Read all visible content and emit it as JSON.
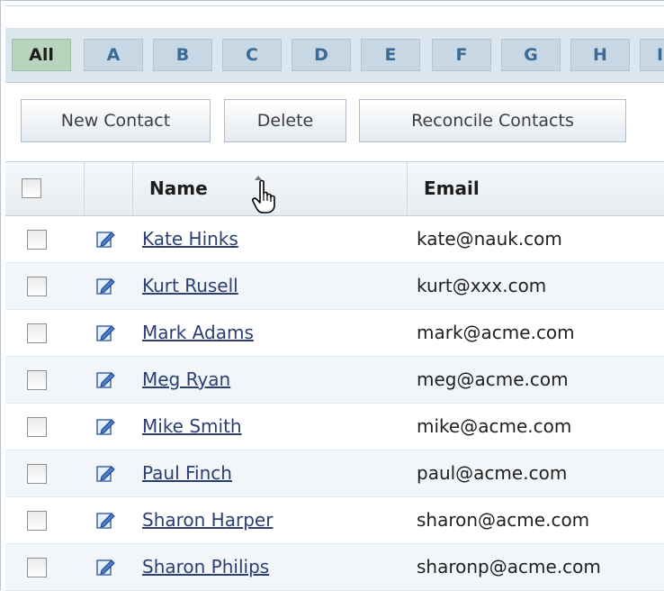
{
  "alphabet": {
    "tabs": [
      "All",
      "A",
      "B",
      "C",
      "D",
      "E",
      "F",
      "G",
      "H",
      "I"
    ],
    "active": "All"
  },
  "toolbar": {
    "new_contact": "New Contact",
    "delete": "Delete",
    "reconcile": "Reconcile Contacts"
  },
  "table": {
    "columns": {
      "name": "Name",
      "email": "Email"
    },
    "sort": {
      "column": "Name",
      "direction": "ascending"
    },
    "rows": [
      {
        "name": "Kate Hinks",
        "email": "kate@nauk.com"
      },
      {
        "name": "Kurt Rusell",
        "email": "kurt@xxx.com"
      },
      {
        "name": "Mark Adams",
        "email": "mark@acme.com"
      },
      {
        "name": "Meg Ryan",
        "email": "meg@acme.com"
      },
      {
        "name": "Mike Smith",
        "email": "mike@acme.com"
      },
      {
        "name": "Paul Finch",
        "email": "paul@acme.com"
      },
      {
        "name": "Sharon Harper",
        "email": "sharon@acme.com"
      },
      {
        "name": "Sharon Philips",
        "email": "sharonp@acme.com"
      }
    ]
  },
  "icons": {
    "edit": "edit-pencil-icon",
    "sort": "sort-ascending-icon",
    "cursor": "hand-pointer-icon"
  },
  "colors": {
    "link": "#2b3f75",
    "active_tab": "#b7d4bd",
    "tab": "#c7d7e4",
    "tab_text": "#3c6a96"
  }
}
